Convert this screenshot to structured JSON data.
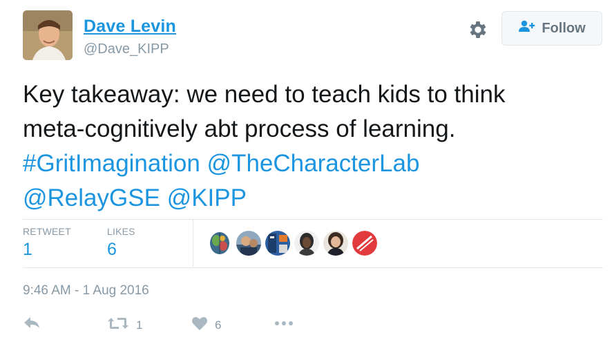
{
  "user": {
    "name": "Dave Levin",
    "handle": "@Dave_KIPP"
  },
  "follow_button": {
    "label": "Follow"
  },
  "tweet": {
    "line1": "Key takeaway: we need to teach kids to think",
    "line2": "meta-cognitively abt process of learning.",
    "hashtag": "#GritImagination",
    "mention1": "@TheCharacterLab",
    "mention2": "@RelayGSE",
    "mention3": "@KIPP"
  },
  "stats": {
    "retweets_label": "RETWEET",
    "retweets_count": "1",
    "likes_label": "LIKES",
    "likes_count": "6"
  },
  "timestamp": "9:46 AM - 1 Aug 2016",
  "actions": {
    "retweet_count": "1",
    "like_count": "6"
  },
  "colors": {
    "link": "#1b95e0",
    "muted": "#8899a6",
    "text": "#14171a"
  },
  "icons": [
    "gear-icon",
    "follow-user-icon",
    "reply-icon",
    "retweet-icon",
    "heart-icon",
    "more-icon"
  ]
}
